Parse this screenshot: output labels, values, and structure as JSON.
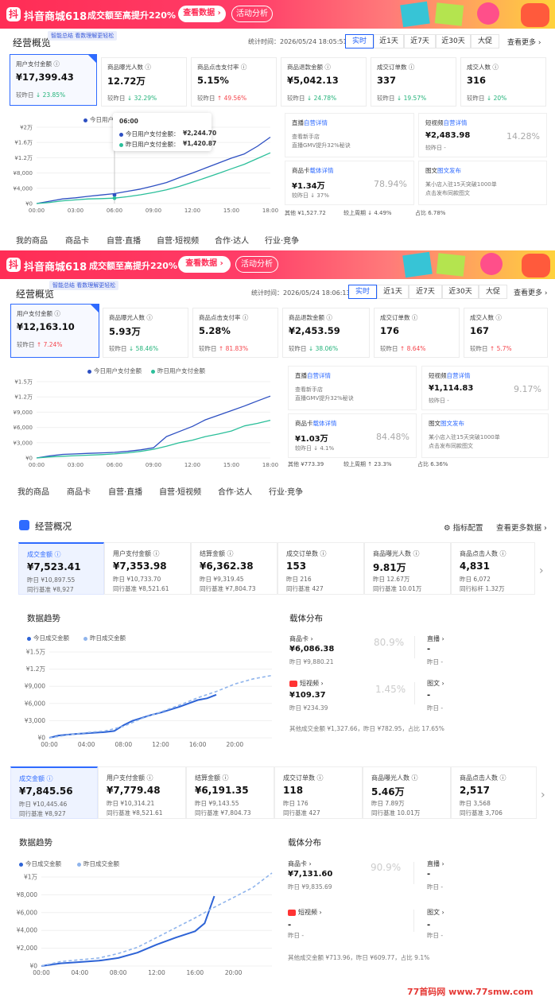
{
  "colors": {
    "today": "#2d4fc2",
    "yesterday": "#2bbf9a",
    "today3": "#2d63d6",
    "yesterday3": "#8fb4ec"
  },
  "p1": {
    "banner": {
      "logo": "抖",
      "title": "抖音商城618",
      "slogan": "成交额至高提升220%",
      "btn1": "查看数据 ›",
      "btn2": "活动分析"
    },
    "title": "经营概览",
    "tag": "智能总结 看数理解更轻松",
    "stat_time": "统计时间：2026/05/24 18:05:51",
    "filters": [
      "实时",
      "近1天",
      "近7天",
      "近30天",
      "大促"
    ],
    "more": "查看更多 ›",
    "cards": [
      {
        "label": "用户支付金额 ⓘ",
        "value": "¥17,399.43",
        "cmp_label": "较昨日",
        "dir": "↓",
        "pct": "23.85%"
      },
      {
        "label": "商品曝光人数 ⓘ",
        "value": "12.72万",
        "cmp_label": "较昨日",
        "dir": "↓",
        "pct": "32.29%"
      },
      {
        "label": "商品点击支付率 ⓘ",
        "value": "5.15%",
        "cmp_label": "较昨日",
        "dir": "↑",
        "pct": "49.56%"
      },
      {
        "label": "商品退款金额 ⓘ",
        "value": "¥5,042.13",
        "cmp_label": "较昨日",
        "dir": "↓",
        "pct": "24.78%"
      },
      {
        "label": "成交订单数 ⓘ",
        "value": "337",
        "cmp_label": "较昨日",
        "dir": "↓",
        "pct": "19.57%"
      },
      {
        "label": "成交人数 ⓘ",
        "value": "316",
        "cmp_label": "较昨日",
        "dir": "↓",
        "pct": "20%"
      }
    ],
    "tooltip": {
      "time": "06:00",
      "today": "今日用户支付金额：",
      "today_v": "¥2,244.70",
      "yest": "昨日用户支付金额：",
      "yest_v": "¥1,420.87"
    },
    "legend_today": "今日用户",
    "rcards": [
      {
        "t1": "直播",
        "t2": "自营详情",
        "v": "",
        "s1": "查看新手店",
        "s2": "直播GMV提升32%秘诀",
        "p": ""
      },
      {
        "t1": "短视频",
        "t2": "自营详情",
        "v": "¥2,483.98",
        "s1": "较昨日 -",
        "s2": "",
        "p": "14.28%"
      },
      {
        "t1": "商品卡",
        "t2": "载体详情",
        "v": "¥1.34万",
        "s1": "较昨日 ↓ 37%",
        "s2": "",
        "p": "78.94%"
      },
      {
        "t1": "图文",
        "t2": "图文发布",
        "v": "",
        "s1": "某小店入驻15天突破1000单",
        "s2": "点击发布同款图文",
        "p": ""
      }
    ],
    "foot": [
      "其他 ¥1,527.72",
      "较上周期 ↓ 4.49%",
      "占比 6.78%"
    ],
    "nav": [
      "我的商品",
      "商品卡",
      "自营·直播",
      "自营·短视频",
      "合作·达人",
      "行业·竞争"
    ]
  },
  "p2": {
    "banner": {
      "logo": "抖",
      "title": "抖音商城618",
      "slogan": "成交额至高提升220%",
      "btn1": "查看数据 ›",
      "btn2": "活动分析"
    },
    "title": "经营概览",
    "tag": "智能总结 看数理解更轻松",
    "stat_time": "统计时间：2026/05/24 18:06:13",
    "filters": [
      "实时",
      "近1天",
      "近7天",
      "近30天",
      "大促"
    ],
    "more": "查看更多 ›",
    "cards": [
      {
        "label": "用户支付金额 ⓘ",
        "value": "¥12,163.10",
        "cmp_label": "较昨日",
        "dir": "↑",
        "pct": "7.24%"
      },
      {
        "label": "商品曝光人数 ⓘ",
        "value": "5.93万",
        "cmp_label": "较昨日",
        "dir": "↓",
        "pct": "58.46%"
      },
      {
        "label": "商品点击支付率 ⓘ",
        "value": "5.28%",
        "cmp_label": "较昨日",
        "dir": "↑",
        "pct": "81.83%"
      },
      {
        "label": "商品退款金额 ⓘ",
        "value": "¥2,453.59",
        "cmp_label": "较昨日",
        "dir": "↓",
        "pct": "38.06%"
      },
      {
        "label": "成交订单数 ⓘ",
        "value": "176",
        "cmp_label": "较昨日",
        "dir": "↑",
        "pct": "8.64%"
      },
      {
        "label": "成交人数 ⓘ",
        "value": "167",
        "cmp_label": "较昨日",
        "dir": "↑",
        "pct": "5.7%"
      }
    ],
    "legend": [
      "今日用户支付金额",
      "昨日用户支付金额"
    ],
    "rcards": [
      {
        "t1": "直播",
        "t2": "自营详情",
        "v": "",
        "s1": "查看新手店",
        "s2": "直播GMV提升32%秘诀",
        "p": ""
      },
      {
        "t1": "短视频",
        "t2": "自营详情",
        "v": "¥1,114.83",
        "s1": "较昨日 -",
        "s2": "",
        "p": "9.17%"
      },
      {
        "t1": "商品卡",
        "t2": "载体详情",
        "v": "¥1.03万",
        "s1": "较昨日 ↓ 4.1%",
        "s2": "",
        "p": "84.48%"
      },
      {
        "t1": "图文",
        "t2": "图文发布",
        "v": "",
        "s1": "某小店入驻15天突破1000单",
        "s2": "点击发布同款图文",
        "p": ""
      }
    ],
    "foot": [
      "其他 ¥773.39",
      "较上周期 ↑ 23.3%",
      "占比 6.36%"
    ],
    "nav": [
      "我的商品",
      "商品卡",
      "自营·直播",
      "自营·短视频",
      "合作·达人",
      "行业·竞争"
    ]
  },
  "p3": {
    "title": "经营概况",
    "config": "⚙ 指标配置",
    "more": "查看更多数据 ›",
    "cards": [
      {
        "label": "成交金额 ⓘ",
        "value": "¥7,523.41",
        "l2": "昨日 ¥10,897.55",
        "l3": "同行基准 ¥8,927"
      },
      {
        "label": "用户支付金额 ⓘ",
        "value": "¥7,353.98",
        "l2": "昨日 ¥10,733.70",
        "l3": "同行基准 ¥8,521.61"
      },
      {
        "label": "结算金额 ⓘ",
        "value": "¥6,362.38",
        "l2": "昨日 ¥9,319.45",
        "l3": "同行基准 ¥7,804.73"
      },
      {
        "label": "成交订单数 ⓘ",
        "value": "153",
        "l2": "昨日 216",
        "l3": "同行基准 427"
      },
      {
        "label": "商品曝光人数 ⓘ",
        "value": "9.81万",
        "l2": "昨日 12.67万",
        "l3": "同行基准 10.01万"
      },
      {
        "label": "商品点击人数 ⓘ",
        "value": "4,831",
        "l2": "昨日 6,072",
        "l3": "同行标杆 1.32万"
      }
    ],
    "trend_title": "数据趋势",
    "legend": [
      "今日成交金额",
      "昨日成交金额"
    ],
    "dist_title": "载体分布",
    "dist": {
      "card_label": "商品卡 ›",
      "card_v": "¥6,086.38",
      "card_s": "昨日 ¥9,880.21",
      "card_p": "80.9%",
      "live_label": "直播 ›",
      "live_v": "-",
      "live_s": "昨日 -",
      "video_label": "短视频 ›",
      "video_v": "¥109.37",
      "video_s": "昨日 ¥234.39",
      "video_p": "1.45%",
      "img_label": "图文 ›",
      "img_v": "-",
      "img_s": "昨日 -",
      "other": "其他成交金额 ¥1,327.66，昨日 ¥782.95，占比 17.65%"
    }
  },
  "p4": {
    "cards": [
      {
        "label": "成交金额 ⓘ",
        "value": "¥7,845.56",
        "l2": "昨日 ¥10,445.46",
        "l3": "同行基准 ¥8,927"
      },
      {
        "label": "用户支付金额 ⓘ",
        "value": "¥7,779.48",
        "l2": "昨日 ¥10,314.21",
        "l3": "同行基准 ¥8,521.61"
      },
      {
        "label": "结算金额 ⓘ",
        "value": "¥6,191.35",
        "l2": "昨日 ¥9,143.55",
        "l3": "同行基准 ¥7,804.73"
      },
      {
        "label": "成交订单数 ⓘ",
        "value": "118",
        "l2": "昨日 176",
        "l3": "同行基准 427"
      },
      {
        "label": "商品曝光人数 ⓘ",
        "value": "5.46万",
        "l2": "昨日 7.89万",
        "l3": "同行基准 10.01万"
      },
      {
        "label": "商品点击人数 ⓘ",
        "value": "2,517",
        "l2": "昨日 3,568",
        "l3": "同行基准 3,706"
      }
    ],
    "trend_title": "数据趋势",
    "legend": [
      "今日成交金额",
      "昨日成交金额"
    ],
    "dist_title": "载体分布",
    "dist": {
      "card_label": "商品卡 ›",
      "card_v": "¥7,131.60",
      "card_s": "昨日 ¥9,835.69",
      "card_p": "90.9%",
      "live_label": "直播 ›",
      "live_v": "-",
      "live_s": "昨日 -",
      "video_label": "短视频 ›",
      "video_v": "-",
      "video_s": "昨日 -",
      "img_label": "图文 ›",
      "img_v": "-",
      "img_s": "昨日 -",
      "other": "其他成交金额 ¥713.96，昨日 ¥609.77，占比 9.1%"
    }
  },
  "watermark": {
    "a": "77首码网",
    "b": "www.77smw.com"
  },
  "chart_data": [
    {
      "type": "line",
      "id": "c1",
      "x": [
        "00:00",
        "03:00",
        "06:00",
        "09:00",
        "12:00",
        "15:00",
        "18:00"
      ],
      "yticks": [
        "¥0",
        "¥4,000",
        "¥8,000",
        "¥1.2万",
        "¥1.6万",
        "¥2万"
      ],
      "ylim": [
        0,
        20000
      ],
      "series": [
        {
          "name": "今日用户支付金额",
          "points": [
            [
              0,
              0
            ],
            [
              1,
              600
            ],
            [
              2,
              1200
            ],
            [
              3,
              1500
            ],
            [
              4,
              1900
            ],
            [
              5,
              2245
            ],
            [
              6,
              2600
            ],
            [
              7,
              3200
            ],
            [
              8,
              3800
            ],
            [
              9,
              4600
            ],
            [
              10,
              5500
            ],
            [
              11,
              6800
            ],
            [
              12,
              8000
            ],
            [
              13,
              9300
            ],
            [
              14,
              10600
            ],
            [
              15,
              11900
            ],
            [
              16,
              13000
            ],
            [
              17,
              15000
            ],
            [
              18,
              17399
            ]
          ]
        },
        {
          "name": "昨日用户支付金额",
          "points": [
            [
              0,
              0
            ],
            [
              1,
              300
            ],
            [
              2,
              700
            ],
            [
              3,
              950
            ],
            [
              4,
              1200
            ],
            [
              5,
              1300
            ],
            [
              6,
              1421
            ],
            [
              7,
              1800
            ],
            [
              8,
              2300
            ],
            [
              9,
              2900
            ],
            [
              10,
              3600
            ],
            [
              11,
              4500
            ],
            [
              12,
              5600
            ],
            [
              13,
              6700
            ],
            [
              14,
              7900
            ],
            [
              15,
              9100
            ],
            [
              16,
              10300
            ],
            [
              17,
              11800
            ],
            [
              18,
              13300
            ]
          ]
        }
      ]
    },
    {
      "type": "line",
      "id": "c2",
      "x": [
        "00:00",
        "03:00",
        "06:00",
        "09:00",
        "12:00",
        "15:00",
        "18:00"
      ],
      "yticks": [
        "¥0",
        "¥3,000",
        "¥6,000",
        "¥9,000",
        "¥1.2万",
        "¥1.5万"
      ],
      "ylim": [
        0,
        15000
      ],
      "series": [
        {
          "name": "今日用户支付金额",
          "points": [
            [
              0,
              0
            ],
            [
              1,
              400
            ],
            [
              2,
              700
            ],
            [
              3,
              800
            ],
            [
              4,
              900
            ],
            [
              5,
              1000
            ],
            [
              6,
              1100
            ],
            [
              7,
              1300
            ],
            [
              8,
              1600
            ],
            [
              9,
              2000
            ],
            [
              10,
              4200
            ],
            [
              11,
              5200
            ],
            [
              12,
              6200
            ],
            [
              13,
              7500
            ],
            [
              14,
              8400
            ],
            [
              15,
              9300
            ],
            [
              16,
              10200
            ],
            [
              17,
              11200
            ],
            [
              18,
              12163
            ]
          ]
        },
        {
          "name": "昨日用户支付金额",
          "points": [
            [
              0,
              0
            ],
            [
              1,
              200
            ],
            [
              2,
              350
            ],
            [
              3,
              450
            ],
            [
              4,
              550
            ],
            [
              5,
              650
            ],
            [
              6,
              800
            ],
            [
              7,
              1000
            ],
            [
              8,
              1300
            ],
            [
              9,
              1700
            ],
            [
              10,
              2300
            ],
            [
              11,
              3000
            ],
            [
              12,
              3500
            ],
            [
              13,
              4200
            ],
            [
              14,
              4700
            ],
            [
              15,
              5300
            ],
            [
              16,
              6300
            ],
            [
              17,
              6800
            ],
            [
              18,
              7400
            ]
          ]
        }
      ]
    },
    {
      "type": "line",
      "id": "c3",
      "x": [
        "00:00",
        "04:00",
        "08:00",
        "12:00",
        "16:00",
        "20:00"
      ],
      "yticks": [
        "¥0",
        "¥3,000",
        "¥6,000",
        "¥9,000",
        "¥1.2万",
        "¥1.5万"
      ],
      "ylim": [
        0,
        15000
      ],
      "series": [
        {
          "name": "今日成交金额",
          "points": [
            [
              0,
              0
            ],
            [
              1,
              400
            ],
            [
              2,
              550
            ],
            [
              3,
              700
            ],
            [
              4,
              800
            ],
            [
              5,
              900
            ],
            [
              6,
              1000
            ],
            [
              7,
              1200
            ],
            [
              8,
              2200
            ],
            [
              9,
              3000
            ],
            [
              10,
              3500
            ],
            [
              11,
              4000
            ],
            [
              12,
              4400
            ],
            [
              13,
              4900
            ],
            [
              14,
              5400
            ],
            [
              15,
              6000
            ],
            [
              16,
              6600
            ],
            [
              17,
              6900
            ],
            [
              18,
              7523
            ]
          ]
        },
        {
          "name": "昨日成交金额",
          "points": [
            [
              0,
              0
            ],
            [
              2,
              500
            ],
            [
              4,
              900
            ],
            [
              6,
              1200
            ],
            [
              8,
              2000
            ],
            [
              10,
              3400
            ],
            [
              12,
              4500
            ],
            [
              14,
              5700
            ],
            [
              16,
              7000
            ],
            [
              18,
              8100
            ],
            [
              20,
              9400
            ],
            [
              22,
              10300
            ],
            [
              24,
              10898
            ]
          ]
        }
      ]
    },
    {
      "type": "line",
      "id": "c4",
      "x": [
        "00:00",
        "04:00",
        "08:00",
        "12:00",
        "16:00",
        "20:00"
      ],
      "yticks": [
        "¥0",
        "¥2,000",
        "¥4,000",
        "¥6,000",
        "¥8,000",
        "¥1万"
      ],
      "ylim": [
        0,
        10000
      ],
      "series": [
        {
          "name": "今日成交金额",
          "points": [
            [
              0,
              0
            ],
            [
              2,
              300
            ],
            [
              4,
              450
            ],
            [
              6,
              600
            ],
            [
              8,
              900
            ],
            [
              10,
              1500
            ],
            [
              12,
              2400
            ],
            [
              14,
              3200
            ],
            [
              16,
              3900
            ],
            [
              17,
              4800
            ],
            [
              18,
              7846
            ]
          ]
        },
        {
          "name": "昨日成交金额",
          "points": [
            [
              0,
              0
            ],
            [
              2,
              500
            ],
            [
              4,
              700
            ],
            [
              6,
              900
            ],
            [
              8,
              1400
            ],
            [
              10,
              2100
            ],
            [
              12,
              3200
            ],
            [
              14,
              4300
            ],
            [
              16,
              5400
            ],
            [
              18,
              6600
            ],
            [
              20,
              7700
            ],
            [
              22,
              8800
            ],
            [
              24,
              10445
            ]
          ]
        }
      ]
    }
  ]
}
